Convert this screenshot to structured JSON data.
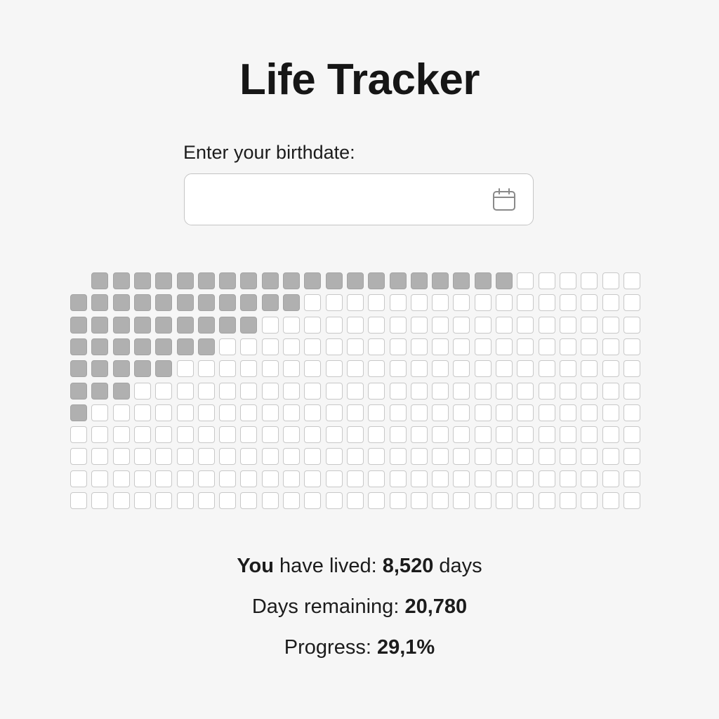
{
  "app": {
    "title": "Life Tracker"
  },
  "birthdate": {
    "label": "Enter your birthdate:",
    "value": "",
    "placeholder": ""
  },
  "icons": {
    "calendar": "calendar-icon"
  },
  "life_grid": {
    "rows": 11,
    "cols": 27,
    "filled_per_row": [
      20,
      11,
      9,
      7,
      5,
      3,
      1,
      0,
      0,
      0,
      0
    ],
    "row_start_col": [
      1,
      0,
      0,
      0,
      0,
      0,
      0,
      0,
      0,
      0,
      0
    ],
    "filled_color": "#b0b0b0",
    "empty_color": "#ffffff"
  },
  "stats": {
    "lived_prefix": "You",
    "lived_label": "have lived:",
    "lived_value": "8,520",
    "lived_unit": "days",
    "remaining_label": "Days remaining:",
    "remaining_value": "20,780",
    "progress_label": "Progress:",
    "progress_value": "29,1%"
  }
}
